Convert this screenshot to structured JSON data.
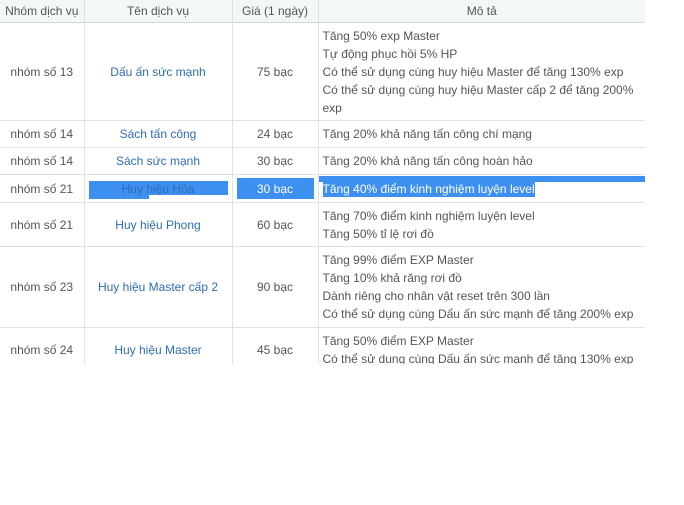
{
  "table": {
    "headers": [
      "Nhóm dịch vụ",
      "Tên dịch vụ",
      "Giá (1 ngày)",
      "Mô tả"
    ],
    "rows": [
      {
        "group": "nhóm số 13",
        "service": "Dấu ấn sức mạnh",
        "price": "75 bạc",
        "desc": [
          "Tăng 50% exp Master",
          "Tự động phục hồi 5% HP",
          "Có thể sử dụng cùng huy hiệu Master để tăng 130% exp",
          "Có thể sử dụng cùng huy hiệu Master cấp 2 để tăng 200%",
          "exp"
        ]
      },
      {
        "group": "nhóm số 14",
        "service": "Sách tấn công",
        "price": "24 bạc",
        "desc": [
          "Tăng 20% khả năng tấn công chí mạng"
        ]
      },
      {
        "group": "nhóm số 14",
        "service": "Sách sức mạnh",
        "price": "30 bạc",
        "desc": [
          "Tăng 20% khả năng tấn công hoàn hảo"
        ]
      },
      {
        "group": "nhóm số 21",
        "service": "Huy hiệu Hỏa",
        "price": "30 bạc",
        "desc": [
          "Tăng 40% điểm kinh nghiệm luyện level"
        ],
        "selected": true
      },
      {
        "group": "nhóm số 21",
        "service": "Huy hiệu Phong",
        "price": "60 bạc",
        "desc": [
          "Tăng 70% điểm kinh nghiệm luyện level",
          "Tăng 50% tỉ lệ rơi đồ"
        ]
      },
      {
        "group": "nhóm số 23",
        "service": "Huy hiệu Master cấp 2",
        "price": "90 bạc",
        "desc": [
          "Tăng 99% điểm EXP Master",
          "Tăng 10% khả răng rơi đồ",
          "Dành riêng cho nhân vật reset trên 300 lần",
          "Có thể sử dụng cùng Dấu ấn sức mạnh để tăng 200% exp"
        ]
      },
      {
        "group": "nhóm số 24",
        "service": "Huy hiệu Master",
        "price": "45 bạc",
        "desc": [
          "Tăng 50% điểm EXP Master",
          "Có thể sử dụng cùng Dấu ấn sức mạnh để tăng 130% exp"
        ]
      }
    ]
  },
  "colors": {
    "header_bg": "#f1f8f5",
    "link": "#2f6db5",
    "selection": "#3d8ff0",
    "border": "#dde5e1"
  }
}
